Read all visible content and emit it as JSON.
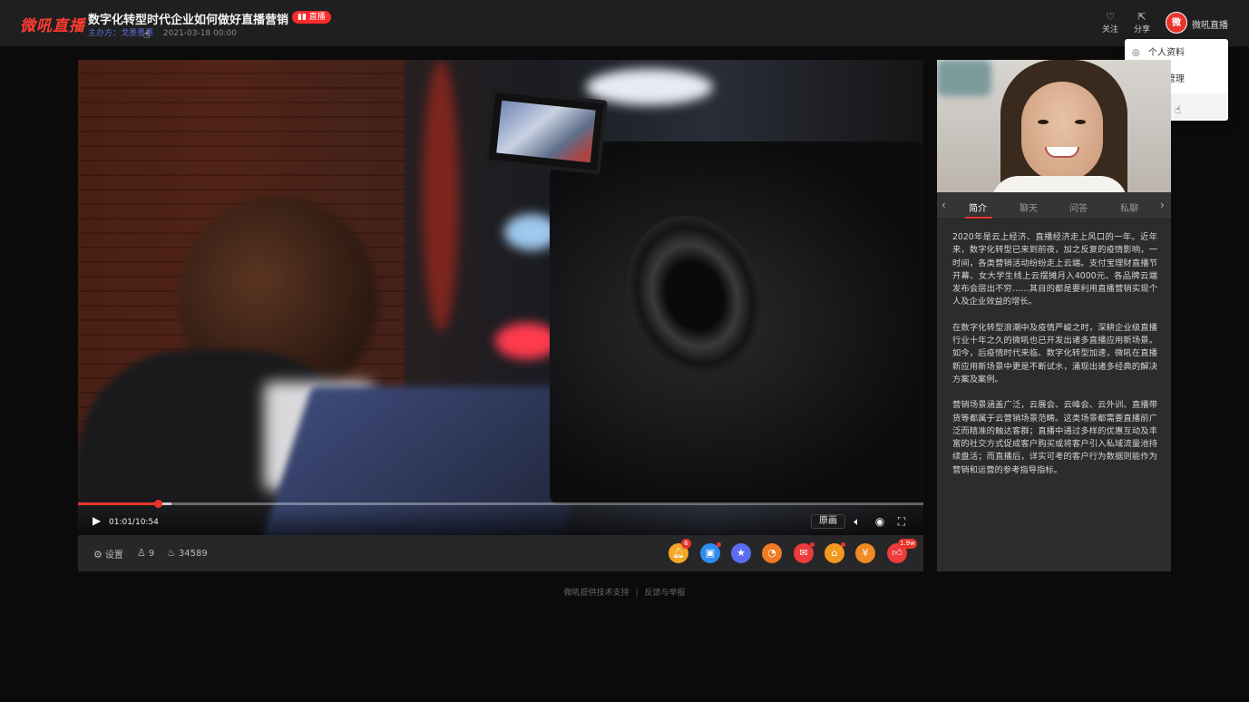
{
  "header": {
    "logo": "微吼直播",
    "title": "数字化转型时代企业如何做好直播营销",
    "live_badge": "▮▮ 直播",
    "host_label": "主办方：",
    "host_name": "戈墨墨墨",
    "date": "2021-03-18 00:00",
    "follow_label": "关注",
    "share_label": "分享",
    "avatar_text": "微",
    "user_name": "微吼直播"
  },
  "dropdown": {
    "items": [
      {
        "label": "个人资料",
        "icon": "user-icon"
      },
      {
        "label": "提现管理",
        "icon": "wallet-icon"
      },
      {
        "label": "退出",
        "icon": "logout-icon"
      }
    ]
  },
  "player": {
    "current_time": "01:01",
    "duration": "10:54",
    "time_display": "01:01/10:54",
    "progress_fraction": 0.094,
    "buffer_fraction": 0.11,
    "quality_label": "原画",
    "accent_color": "#e8352b"
  },
  "toolbar": {
    "settings_label": "设置",
    "online_count": "9",
    "heat_count": "34589",
    "icons": [
      {
        "name": "bell-icon",
        "color": "#f5a623",
        "badge": "6"
      },
      {
        "name": "sign-in-icon",
        "color": "#2d8cf0",
        "badge": ""
      },
      {
        "name": "favorite-icon",
        "color": "#5b6cf0",
        "badge": ""
      },
      {
        "name": "lottery-icon",
        "color": "#f07b24",
        "badge": ""
      },
      {
        "name": "red-packet-icon",
        "color": "#ee3b3b",
        "badge": ""
      },
      {
        "name": "gift-icon",
        "color": "#f29a1f",
        "badge": ""
      },
      {
        "name": "reward-icon",
        "color": "#f08a24",
        "badge": ""
      },
      {
        "name": "like-icon",
        "color": "#ee3b3b",
        "badge": "1.9w"
      }
    ]
  },
  "side": {
    "tabs": [
      "简介",
      "聊天",
      "问答",
      "私聊"
    ],
    "active_tab": 0,
    "intro_paragraphs": [
      "2020年是云上经济、直播经济走上风口的一年。近年来，数字化转型已来到前夜，加之反复的疫情影响，一时间，各类营销活动纷纷走上云端。支付宝理财直播节开幕、女大学生线上云摆摊月入4000元、各品牌云端发布会层出不穷……其目的都是要利用直播营销实现个人及企业效益的增长。",
      "在数字化转型浪潮中及疫情严峻之时，深耕企业级直播行业十年之久的微吼也已开发出诸多直播应用新场景。如今，后疫情时代来临、数字化转型加速，微吼在直播新应用新场景中更是不断试水，涌现出诸多经典的解决方案及案例。",
      "营销场景涵盖广泛，云展会、云峰会、云外训、直播带货等都属于云营销场景范畴。这类场景都需要直播前广泛而精准的触达客群；直播中通过多样的优惠互动及丰富的社交方式促成客户购买或将客户引入私域流量池持续盘活；而直播后，详实可考的客户行为数据则能作为营销和运营的参考指导指标。"
    ]
  },
  "footer": {
    "powered_by": "微吼提供技术支持",
    "separator": "|",
    "report": "反馈与举报"
  }
}
